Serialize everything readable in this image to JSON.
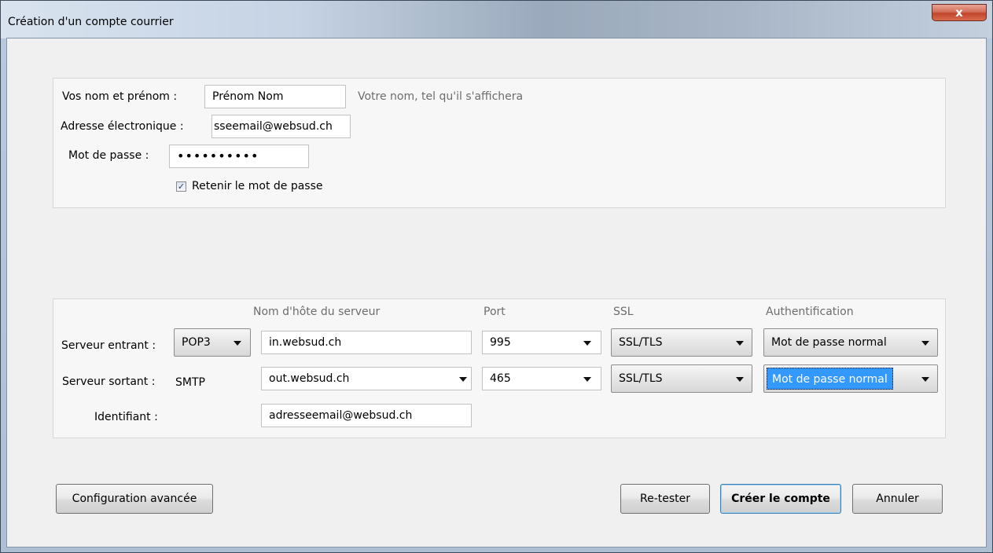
{
  "window": {
    "title": "Création d'un compte courrier",
    "close_label": "x"
  },
  "identity": {
    "name_label": "Vos nom et prénom :",
    "name_value": "Prénom Nom",
    "name_hint": "Votre nom, tel qu'il s'affichera",
    "email_label": "Adresse électronique :",
    "email_value": "sseemail@websud.ch",
    "password_label": "Mot de passe :",
    "password_value": "••••••••••",
    "remember_label": "Retenir le mot de passe",
    "remember_checked": true,
    "check_glyph": "✓"
  },
  "servers": {
    "headers": {
      "hostname": "Nom d'hôte du serveur",
      "port": "Port",
      "ssl": "SSL",
      "auth": "Authentification"
    },
    "incoming": {
      "label": "Serveur entrant :",
      "protocol": "POP3",
      "hostname": "in.websud.ch",
      "port": "995",
      "ssl": "SSL/TLS",
      "auth": "Mot de passe normal"
    },
    "outgoing": {
      "label": "Serveur sortant :",
      "protocol": "SMTP",
      "hostname": "out.websud.ch",
      "port": "465",
      "ssl": "SSL/TLS",
      "auth": "Mot de passe normal"
    },
    "username": {
      "label": "Identifiant :",
      "value": "adresseemail@websud.ch"
    }
  },
  "buttons": {
    "advanced": "Configuration avancée",
    "retest": "Re-tester",
    "create": "Créer le compte",
    "cancel": "Annuler"
  },
  "colors": {
    "selection": "#3399ff",
    "close_button": "#c2452b"
  }
}
